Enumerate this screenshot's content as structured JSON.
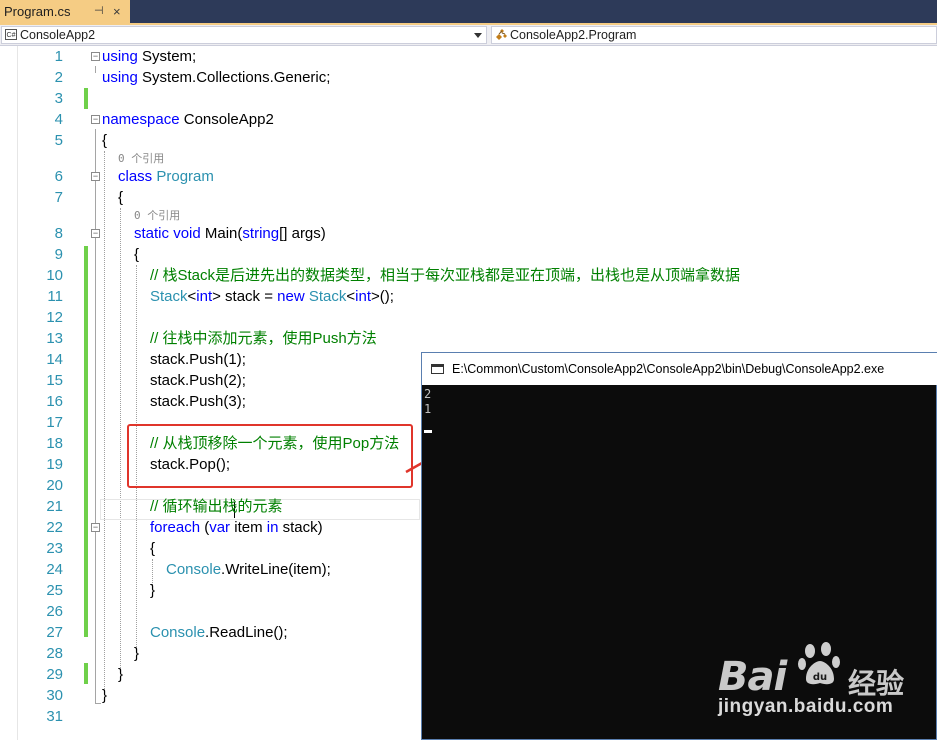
{
  "tab": {
    "title": "Program.cs",
    "pin_icon": "pin-icon",
    "close_label": "×"
  },
  "navbar": {
    "project": "ConsoleApp2",
    "member": "ConsoleApp2.Program"
  },
  "editor": {
    "lines": [
      {
        "n": "1",
        "segs": [
          {
            "t": "using",
            "c": "kw"
          },
          {
            "t": " System;"
          }
        ]
      },
      {
        "n": "2",
        "segs": [
          {
            "t": "using",
            "c": "kw"
          },
          {
            "t": " System.Collections.Generic;"
          }
        ]
      },
      {
        "n": "3",
        "segs": []
      },
      {
        "n": "4",
        "segs": [
          {
            "t": "namespace",
            "c": "kw"
          },
          {
            "t": " ConsoleApp2"
          }
        ]
      },
      {
        "n": "5",
        "segs": [
          {
            "t": "{"
          }
        ]
      },
      {
        "n": "6",
        "segs": [
          {
            "t": "class",
            "c": "kw"
          },
          {
            "t": " "
          },
          {
            "t": "Program",
            "c": "ty"
          }
        ]
      },
      {
        "n": "7",
        "segs": [
          {
            "t": "{"
          }
        ]
      },
      {
        "n": "8",
        "segs": [
          {
            "t": "static",
            "c": "kw"
          },
          {
            "t": " "
          },
          {
            "t": "void",
            "c": "kw"
          },
          {
            "t": " Main("
          },
          {
            "t": "string",
            "c": "kw"
          },
          {
            "t": "[] args)"
          }
        ]
      },
      {
        "n": "9",
        "segs": [
          {
            "t": "{"
          }
        ]
      },
      {
        "n": "10",
        "segs": [
          {
            "t": "// 栈Stack是后进先出的数据类型，相当于每次亚栈都是亚在顶端，出栈也是从顶端拿数据",
            "c": "cm"
          }
        ]
      },
      {
        "n": "11",
        "segs": [
          {
            "t": "Stack",
            "c": "ty"
          },
          {
            "t": "<"
          },
          {
            "t": "int",
            "c": "kw"
          },
          {
            "t": "> stack = "
          },
          {
            "t": "new",
            "c": "kw"
          },
          {
            "t": " "
          },
          {
            "t": "Stack",
            "c": "ty"
          },
          {
            "t": "<"
          },
          {
            "t": "int",
            "c": "kw"
          },
          {
            "t": ">();"
          }
        ]
      },
      {
        "n": "12",
        "segs": []
      },
      {
        "n": "13",
        "segs": [
          {
            "t": "// 往栈中添加元素，使用Push方法",
            "c": "cm"
          }
        ]
      },
      {
        "n": "14",
        "segs": [
          {
            "t": "stack.Push(1);"
          }
        ]
      },
      {
        "n": "15",
        "segs": [
          {
            "t": "stack.Push(2);"
          }
        ]
      },
      {
        "n": "16",
        "segs": [
          {
            "t": "stack.Push(3);"
          }
        ]
      },
      {
        "n": "17",
        "segs": []
      },
      {
        "n": "18",
        "segs": [
          {
            "t": "// 从栈顶移除一个元素，使用Pop方法",
            "c": "cm"
          }
        ]
      },
      {
        "n": "19",
        "segs": [
          {
            "t": "stack.Pop();"
          }
        ]
      },
      {
        "n": "20",
        "segs": []
      },
      {
        "n": "21",
        "segs": [
          {
            "t": "// 循环输出栈的元素",
            "c": "cm"
          }
        ]
      },
      {
        "n": "22",
        "segs": [
          {
            "t": "foreach",
            "c": "kw"
          },
          {
            "t": " ("
          },
          {
            "t": "var",
            "c": "kw"
          },
          {
            "t": " item "
          },
          {
            "t": "in",
            "c": "kw"
          },
          {
            "t": " stack)"
          }
        ]
      },
      {
        "n": "23",
        "segs": [
          {
            "t": "{"
          }
        ]
      },
      {
        "n": "24",
        "segs": [
          {
            "t": "Console",
            "c": "ty"
          },
          {
            "t": ".WriteLine(item);"
          }
        ]
      },
      {
        "n": "25",
        "segs": [
          {
            "t": "}"
          }
        ]
      },
      {
        "n": "26",
        "segs": []
      },
      {
        "n": "27",
        "segs": [
          {
            "t": "Console",
            "c": "ty"
          },
          {
            "t": ".ReadLine();"
          }
        ]
      },
      {
        "n": "28",
        "segs": [
          {
            "t": "}"
          }
        ]
      },
      {
        "n": "29",
        "segs": [
          {
            "t": "}"
          }
        ]
      },
      {
        "n": "30",
        "segs": [
          {
            "t": "}"
          }
        ]
      },
      {
        "n": "31",
        "segs": []
      }
    ],
    "codelens": [
      "0 个引用",
      "0 个引用"
    ]
  },
  "console": {
    "title": "E:\\Common\\Custom\\ConsoleApp2\\ConsoleApp2\\bin\\Debug\\ConsoleApp2.exe",
    "output": [
      "2",
      "1"
    ]
  },
  "watermark": {
    "brand": "Bai",
    "brand_suffix": "经验",
    "url": "jingyan.baidu.com"
  },
  "colors": {
    "keyword": "#0000ff",
    "type": "#2b91af",
    "comment": "#008000",
    "tab_active": "#f5cc84",
    "highlight_box": "#e0352b"
  }
}
